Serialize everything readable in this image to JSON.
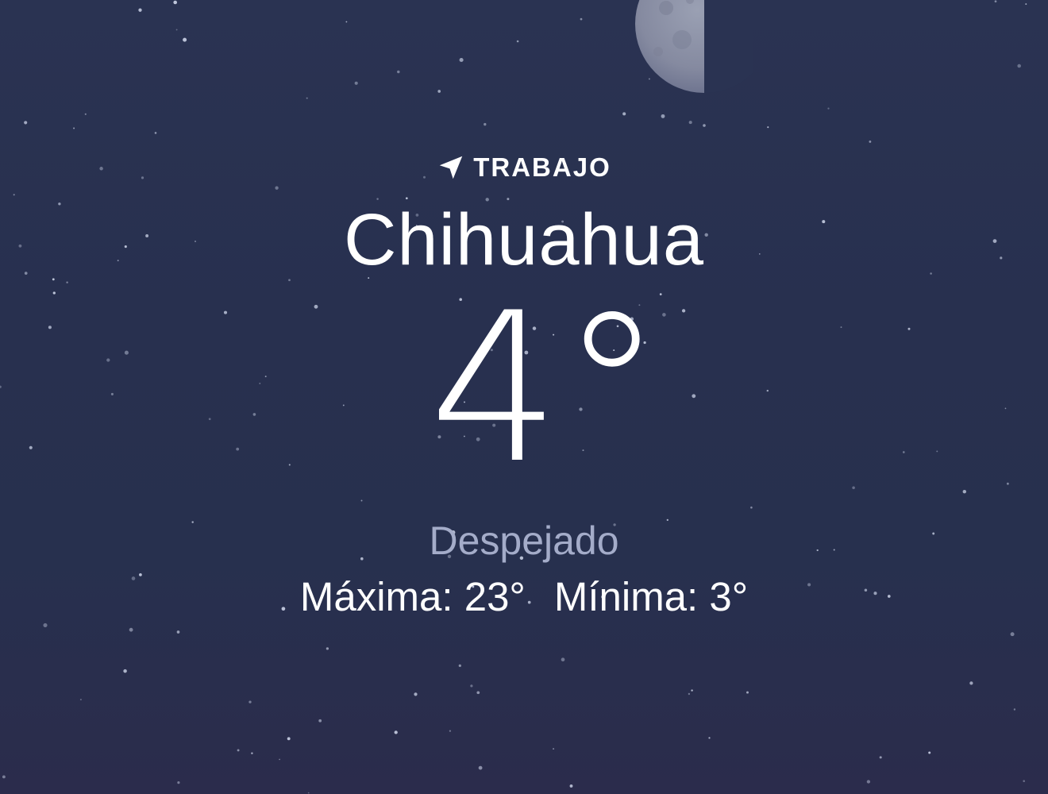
{
  "location": {
    "label": "TRABAJO",
    "icon": "location-arrow-icon",
    "city": "Chihuahua"
  },
  "current": {
    "temperature": "4°",
    "condition": "Despejado"
  },
  "range": {
    "max_label": "Máxima: 23°",
    "min_label": "Mínima: 3°"
  },
  "background": {
    "scene": "night-sky",
    "moon": "half-moon-icon",
    "colors": {
      "sky": "#28304f",
      "condition_text": "#a4acc9",
      "text": "#ffffff"
    }
  }
}
